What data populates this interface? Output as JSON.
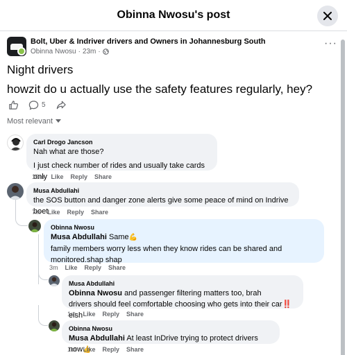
{
  "header": {
    "title": "Obinna Nwosu's post",
    "close_icon": "close-icon"
  },
  "post": {
    "group_name": "Bolt, Uber & Indriver drivers and Owners in Johannesburg South",
    "author": "Obinna Nwosu",
    "time": "23m",
    "separator": "·",
    "title": "Night drivers",
    "body": "howzit do u actually use the safety features regularly, hey?",
    "comment_count": "5"
  },
  "sort": {
    "label": "Most relevant"
  },
  "comments": [
    {
      "name": "Carl Drogo Jancson",
      "line1": "Nah what are those?",
      "line2": "I just check number of rides and usually take cards only",
      "time": "10m",
      "like": "Like",
      "reply": "Reply",
      "share": "Share"
    },
    {
      "name": "Musa Abdullahi",
      "line1": "the SOS button and danger zone alerts give some peace of mind on Indrive boet",
      "time": "7m",
      "like": "Like",
      "reply": "Reply",
      "share": "Share"
    },
    {
      "name": "Obinna Nwosu",
      "mention": "Musa Abdullahi",
      "line1": "Same",
      "emoji1": "💪",
      "line2": "family members worry less when they know rides can be shared and",
      "line3": "monitored.shap shap",
      "time": "3m",
      "like": "Like",
      "reply": "Reply",
      "share": "Share"
    },
    {
      "name": "Musa Abdullahi",
      "mention": "Obinna Nwosu",
      "line1": "and passenger filtering matters too, brah",
      "line2": "drivers should feel comfortable choosing who gets into their car",
      "emoji": "‼️",
      "line2b": "eish",
      "time": "1m",
      "like": "Like",
      "reply": "Reply",
      "share": "Share"
    },
    {
      "name": "Obinna Nwosu",
      "mention": "Musa Abdullahi",
      "line1": "At least InDrive trying to protect drivers now",
      "emoji": "👍",
      "time": "1m",
      "like": "Like",
      "reply": "Reply",
      "share": "Share"
    }
  ]
}
